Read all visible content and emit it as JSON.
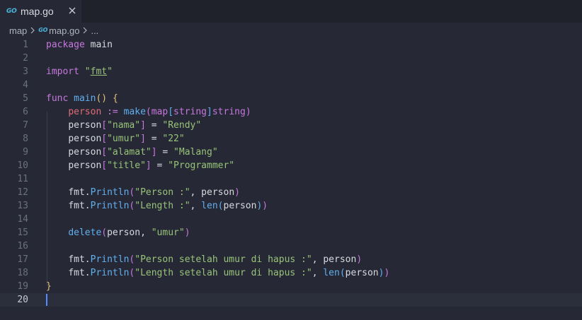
{
  "tab": {
    "label": "map.go",
    "icon": "go-file-icon",
    "icon_text": "GO"
  },
  "breadcrumb": {
    "folder": "map",
    "file": "map.go",
    "symbol": "..."
  },
  "editor": {
    "current_line": 20,
    "lines": [
      {
        "n": "1",
        "tokens": [
          {
            "t": "package",
            "c": "k"
          },
          {
            "t": " main",
            "c": "p"
          }
        ]
      },
      {
        "n": "2",
        "tokens": []
      },
      {
        "n": "3",
        "tokens": [
          {
            "t": "import",
            "c": "k"
          },
          {
            "t": " ",
            "c": "p"
          },
          {
            "t": "\"",
            "c": "s"
          },
          {
            "t": "fmt",
            "c": "s ul"
          },
          {
            "t": "\"",
            "c": "s"
          }
        ]
      },
      {
        "n": "4",
        "tokens": []
      },
      {
        "n": "5",
        "tokens": [
          {
            "t": "func",
            "c": "k"
          },
          {
            "t": " ",
            "c": "p"
          },
          {
            "t": "main",
            "c": "f"
          },
          {
            "t": "()",
            "c": "br1"
          },
          {
            "t": " ",
            "c": "p"
          },
          {
            "t": "{",
            "c": "br1"
          }
        ]
      },
      {
        "n": "6",
        "tokens": [
          {
            "t": "    ",
            "c": "p"
          },
          {
            "t": "person",
            "c": "v"
          },
          {
            "t": " := ",
            "c": "k"
          },
          {
            "t": "make",
            "c": "f"
          },
          {
            "t": "(",
            "c": "br2"
          },
          {
            "t": "map",
            "c": "k"
          },
          {
            "t": "[",
            "c": "br3"
          },
          {
            "t": "string",
            "c": "k"
          },
          {
            "t": "]",
            "c": "br3"
          },
          {
            "t": "string",
            "c": "k"
          },
          {
            "t": ")",
            "c": "br2"
          }
        ]
      },
      {
        "n": "7",
        "tokens": [
          {
            "t": "    ",
            "c": "p"
          },
          {
            "t": "person",
            "c": "p"
          },
          {
            "t": "[",
            "c": "br2"
          },
          {
            "t": "\"nama\"",
            "c": "s"
          },
          {
            "t": "]",
            "c": "br2"
          },
          {
            "t": " = ",
            "c": "p"
          },
          {
            "t": "\"Rendy\"",
            "c": "s"
          }
        ]
      },
      {
        "n": "8",
        "tokens": [
          {
            "t": "    ",
            "c": "p"
          },
          {
            "t": "person",
            "c": "p"
          },
          {
            "t": "[",
            "c": "br2"
          },
          {
            "t": "\"umur\"",
            "c": "s"
          },
          {
            "t": "]",
            "c": "br2"
          },
          {
            "t": " = ",
            "c": "p"
          },
          {
            "t": "\"22\"",
            "c": "s"
          }
        ]
      },
      {
        "n": "9",
        "tokens": [
          {
            "t": "    ",
            "c": "p"
          },
          {
            "t": "person",
            "c": "p"
          },
          {
            "t": "[",
            "c": "br2"
          },
          {
            "t": "\"alamat\"",
            "c": "s"
          },
          {
            "t": "]",
            "c": "br2"
          },
          {
            "t": " = ",
            "c": "p"
          },
          {
            "t": "\"Malang\"",
            "c": "s"
          }
        ]
      },
      {
        "n": "10",
        "tokens": [
          {
            "t": "    ",
            "c": "p"
          },
          {
            "t": "person",
            "c": "p"
          },
          {
            "t": "[",
            "c": "br2"
          },
          {
            "t": "\"title\"",
            "c": "s"
          },
          {
            "t": "]",
            "c": "br2"
          },
          {
            "t": " = ",
            "c": "p"
          },
          {
            "t": "\"Programmer\"",
            "c": "s"
          }
        ]
      },
      {
        "n": "11",
        "tokens": []
      },
      {
        "n": "12",
        "tokens": [
          {
            "t": "    ",
            "c": "p"
          },
          {
            "t": "fmt",
            "c": "p"
          },
          {
            "t": ".",
            "c": "p"
          },
          {
            "t": "Println",
            "c": "f"
          },
          {
            "t": "(",
            "c": "br2"
          },
          {
            "t": "\"Person :\"",
            "c": "s"
          },
          {
            "t": ", person",
            "c": "p"
          },
          {
            "t": ")",
            "c": "br2"
          }
        ]
      },
      {
        "n": "13",
        "tokens": [
          {
            "t": "    ",
            "c": "p"
          },
          {
            "t": "fmt",
            "c": "p"
          },
          {
            "t": ".",
            "c": "p"
          },
          {
            "t": "Println",
            "c": "f"
          },
          {
            "t": "(",
            "c": "br2"
          },
          {
            "t": "\"Length :\"",
            "c": "s"
          },
          {
            "t": ", ",
            "c": "p"
          },
          {
            "t": "len",
            "c": "f"
          },
          {
            "t": "(",
            "c": "br3"
          },
          {
            "t": "person",
            "c": "p"
          },
          {
            "t": ")",
            "c": "br3"
          },
          {
            "t": ")",
            "c": "br2"
          }
        ]
      },
      {
        "n": "14",
        "tokens": []
      },
      {
        "n": "15",
        "tokens": [
          {
            "t": "    ",
            "c": "p"
          },
          {
            "t": "delete",
            "c": "f"
          },
          {
            "t": "(",
            "c": "br2"
          },
          {
            "t": "person, ",
            "c": "p"
          },
          {
            "t": "\"umur\"",
            "c": "s"
          },
          {
            "t": ")",
            "c": "br2"
          }
        ]
      },
      {
        "n": "16",
        "tokens": []
      },
      {
        "n": "17",
        "tokens": [
          {
            "t": "    ",
            "c": "p"
          },
          {
            "t": "fmt",
            "c": "p"
          },
          {
            "t": ".",
            "c": "p"
          },
          {
            "t": "Println",
            "c": "f"
          },
          {
            "t": "(",
            "c": "br2"
          },
          {
            "t": "\"Person setelah umur di hapus :\"",
            "c": "s"
          },
          {
            "t": ", person",
            "c": "p"
          },
          {
            "t": ")",
            "c": "br2"
          }
        ]
      },
      {
        "n": "18",
        "tokens": [
          {
            "t": "    ",
            "c": "p"
          },
          {
            "t": "fmt",
            "c": "p"
          },
          {
            "t": ".",
            "c": "p"
          },
          {
            "t": "Println",
            "c": "f"
          },
          {
            "t": "(",
            "c": "br2"
          },
          {
            "t": "\"Length setelah umur di hapus :\"",
            "c": "s"
          },
          {
            "t": ", ",
            "c": "p"
          },
          {
            "t": "len",
            "c": "f"
          },
          {
            "t": "(",
            "c": "br3"
          },
          {
            "t": "person",
            "c": "p"
          },
          {
            "t": ")",
            "c": "br3"
          },
          {
            "t": ")",
            "c": "br2"
          }
        ]
      },
      {
        "n": "19",
        "tokens": [
          {
            "t": "}",
            "c": "br1"
          }
        ]
      },
      {
        "n": "20",
        "tokens": []
      }
    ]
  },
  "colors": {
    "background": "#262935",
    "tabbar": "#1f212b",
    "keyword": "#c678dd",
    "function": "#61afef",
    "string": "#98c379",
    "variable": "#e06c75",
    "bracket": "#e5c07b",
    "cursor": "#528bff"
  }
}
